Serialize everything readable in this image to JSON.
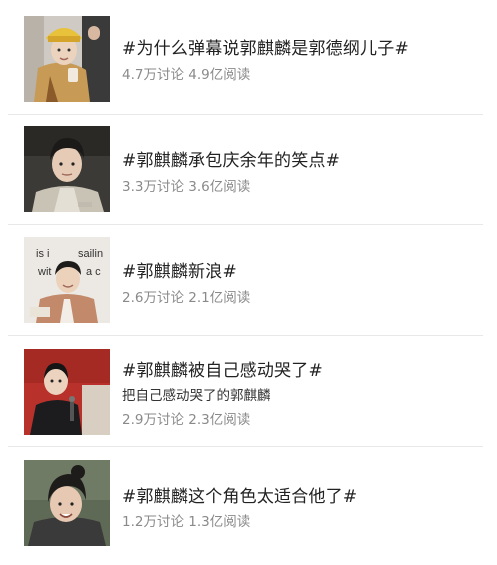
{
  "topics": [
    {
      "title": "#为什么弹幕说郭麒麟是郭德纲儿子#",
      "stats": "4.7万讨论 4.9亿阅读",
      "thumb_icon": "person-with-hat-photo"
    },
    {
      "title": "#郭麒麟承包庆余年的笑点#",
      "stats": "3.3万讨论 3.6亿阅读",
      "thumb_icon": "drama-still-photo"
    },
    {
      "title": "#郭麒麟新浪#",
      "stats": "2.6万讨论 2.1亿阅读",
      "thumb_icon": "event-photo",
      "thumb_text_1": "is i",
      "thumb_text_2": "sailin",
      "thumb_text_3": "wit",
      "thumb_text_4": "a c"
    },
    {
      "title": "#郭麒麟被自己感动哭了#",
      "description": "把自己感动哭了的郭麒麟",
      "stats": "2.9万讨论 2.3亿阅读",
      "thumb_icon": "performance-photo"
    },
    {
      "title": "#郭麒麟这个角色太适合他了#",
      "stats": "1.2万讨论 1.3亿阅读",
      "thumb_icon": "costume-portrait-photo"
    }
  ]
}
